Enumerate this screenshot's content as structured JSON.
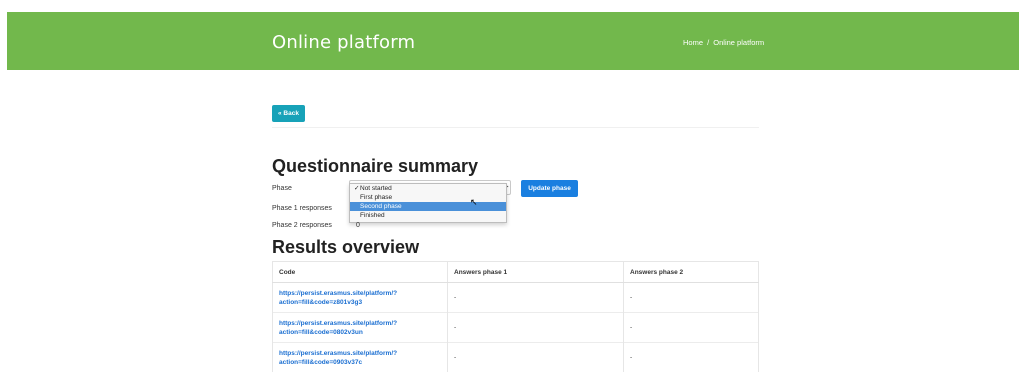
{
  "header": {
    "title": "Online platform",
    "breadcrumb": {
      "home": "Home",
      "separator": "/",
      "current": "Online platform"
    },
    "bg_color": "#72b84c"
  },
  "back_button": {
    "label": "« Back"
  },
  "summary": {
    "heading": "Questionnaire summary",
    "phase_label": "Phase",
    "phase_select": {
      "options": [
        "Not started",
        "First phase",
        "Second phase",
        "Finished"
      ],
      "checked": "Not started",
      "highlighted": "Second phase"
    },
    "update_button": "Update phase",
    "phase1_label": "Phase 1 responses",
    "phase1_value": "",
    "phase2_label": "Phase 2 responses",
    "phase2_value": "0"
  },
  "results": {
    "heading": "Results overview",
    "columns": [
      "Code",
      "Answers phase 1",
      "Answers phase 2"
    ],
    "rows": [
      {
        "code": "https://persist.erasmus.site/platform/?action=fill&code=z801v3g3",
        "a1": "-",
        "a2": "-"
      },
      {
        "code": "https://persist.erasmus.site/platform/?action=fill&code=0802v3un",
        "a1": "-",
        "a2": "-"
      },
      {
        "code": "https://persist.erasmus.site/platform/?action=fill&code=0903v37c",
        "a1": "-",
        "a2": "-"
      }
    ]
  }
}
